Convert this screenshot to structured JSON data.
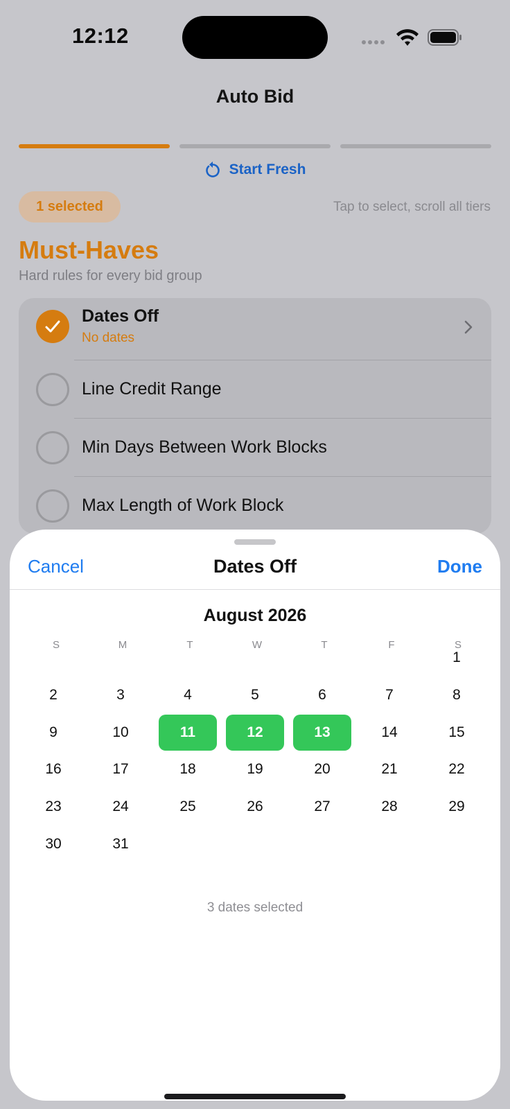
{
  "status": {
    "time": "12:12"
  },
  "nav": {
    "title": "Auto Bid"
  },
  "progress": {
    "steps": 3,
    "current": 1
  },
  "actions": {
    "start_fresh": "Start Fresh"
  },
  "selection": {
    "pill": "1 selected",
    "hint": "Tap to select, scroll all tiers"
  },
  "section": {
    "title": "Must-Haves",
    "subtitle": "Hard rules for every bid group"
  },
  "rules": [
    {
      "label": "Dates Off",
      "sublabel": "No dates",
      "checked": true
    },
    {
      "label": "Line Credit Range",
      "checked": false
    },
    {
      "label": "Min Days Between Work Blocks",
      "checked": false
    },
    {
      "label": "Max Length of Work Block",
      "checked": false
    }
  ],
  "sheet": {
    "cancel": "Cancel",
    "title": "Dates Off",
    "done": "Done",
    "month": "August 2026",
    "weekdays": [
      "S",
      "M",
      "T",
      "W",
      "T",
      "F",
      "S"
    ],
    "days": [
      "1",
      "2",
      "3",
      "4",
      "5",
      "6",
      "7",
      "8",
      "9",
      "10",
      "11",
      "12",
      "13",
      "14",
      "15",
      "16",
      "17",
      "18",
      "19",
      "20",
      "21",
      "22",
      "23",
      "24",
      "25",
      "26",
      "27",
      "28",
      "29",
      "30",
      "31"
    ],
    "selected_days": [
      "11",
      "12",
      "13"
    ],
    "count_text": "3 dates selected"
  },
  "colors": {
    "accent": "#d57c10",
    "link": "#1f7cf0",
    "selected_day": "#34c759"
  }
}
